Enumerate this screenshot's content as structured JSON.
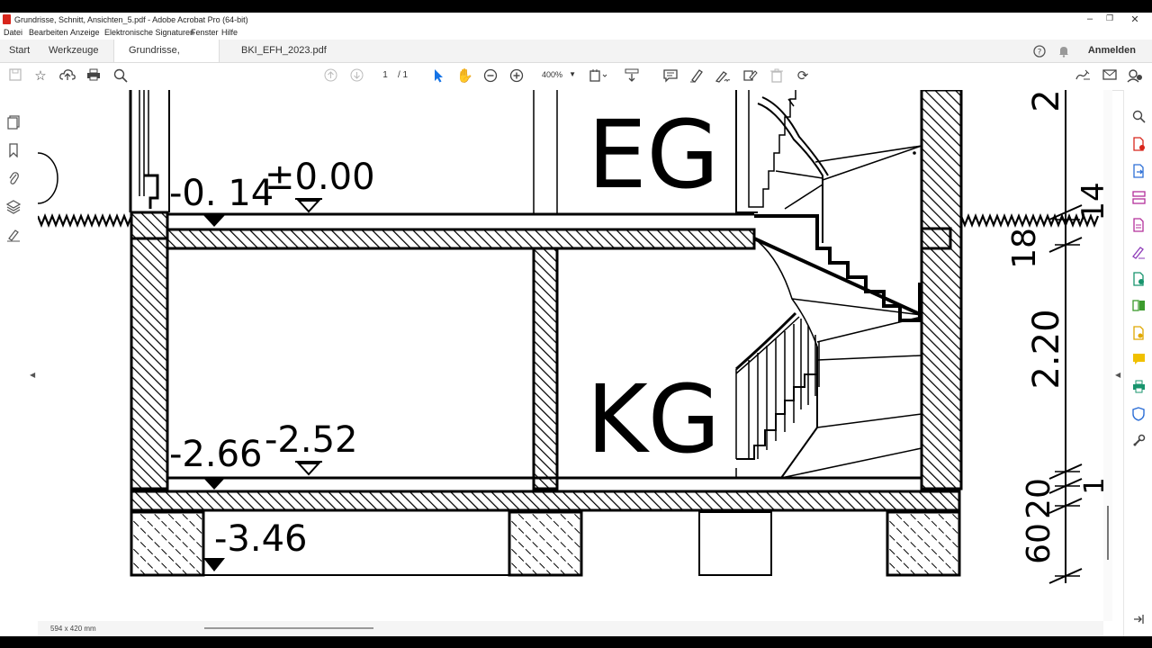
{
  "window": {
    "title": "Grundrisse, Schnitt, Ansichten_5.pdf - Adobe Acrobat Pro (64-bit)",
    "controls": [
      "–",
      "❐",
      "✕"
    ]
  },
  "menu": [
    "Datei",
    "Bearbeiten",
    "Anzeige",
    "Elektronische Signaturen",
    "Fenster",
    "Hilfe"
  ],
  "tabs": {
    "start": "Start",
    "tools": "Werkzeuge",
    "docs": [
      {
        "label": "Grundrisse, Schnitt,...",
        "close": "×"
      },
      {
        "label": "BKI_EFH_2023.pdf"
      }
    ],
    "signin": "Anmelden"
  },
  "toolbar": {
    "page_current": "1",
    "page_total": "/ 1",
    "zoom": "400%"
  },
  "drawing": {
    "rooms": [
      "EG",
      "KG"
    ],
    "levels": [
      "-0. 14",
      "±0.00",
      "-2.66",
      "-2.52",
      "-3.46"
    ],
    "dimensions": [
      "2",
      "14",
      "18",
      "2.20",
      "20",
      "60",
      "1"
    ]
  },
  "statusbar": {
    "page_size": "594 x 420 mm"
  }
}
